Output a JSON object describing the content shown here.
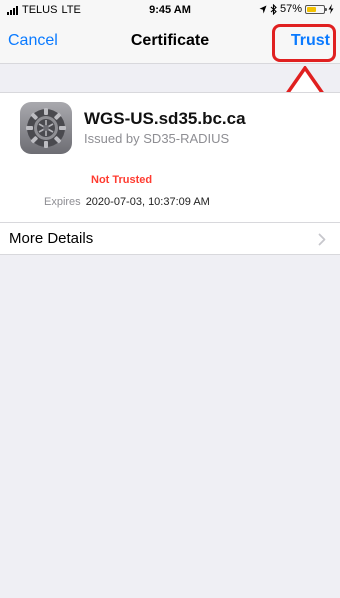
{
  "status_bar": {
    "carrier": "TELUS",
    "network": "LTE",
    "time": "9:45 AM",
    "battery_percent_text": "57%",
    "battery_level": 0.57,
    "icons": [
      "signal-icon",
      "location-icon",
      "bluetooth-icon",
      "battery-icon",
      "charging-icon"
    ]
  },
  "nav": {
    "cancel_label": "Cancel",
    "title": "Certificate",
    "trust_label": "Trust"
  },
  "certificate": {
    "name": "WGS-US.sd35.bc.ca",
    "issuer": "Issued by SD35-RADIUS",
    "status": "Not Trusted",
    "expires_label": "Expires",
    "expires_value": "2020-07-03, 10:37:09 AM",
    "icon": "settings-gear-icon"
  },
  "more_details": {
    "label": "More Details",
    "icon": "chevron-right-icon"
  },
  "colors": {
    "accent": "#0a7aff",
    "warning": "#ff3b30",
    "annotation": "#e02020",
    "battery": "#f2c100"
  }
}
